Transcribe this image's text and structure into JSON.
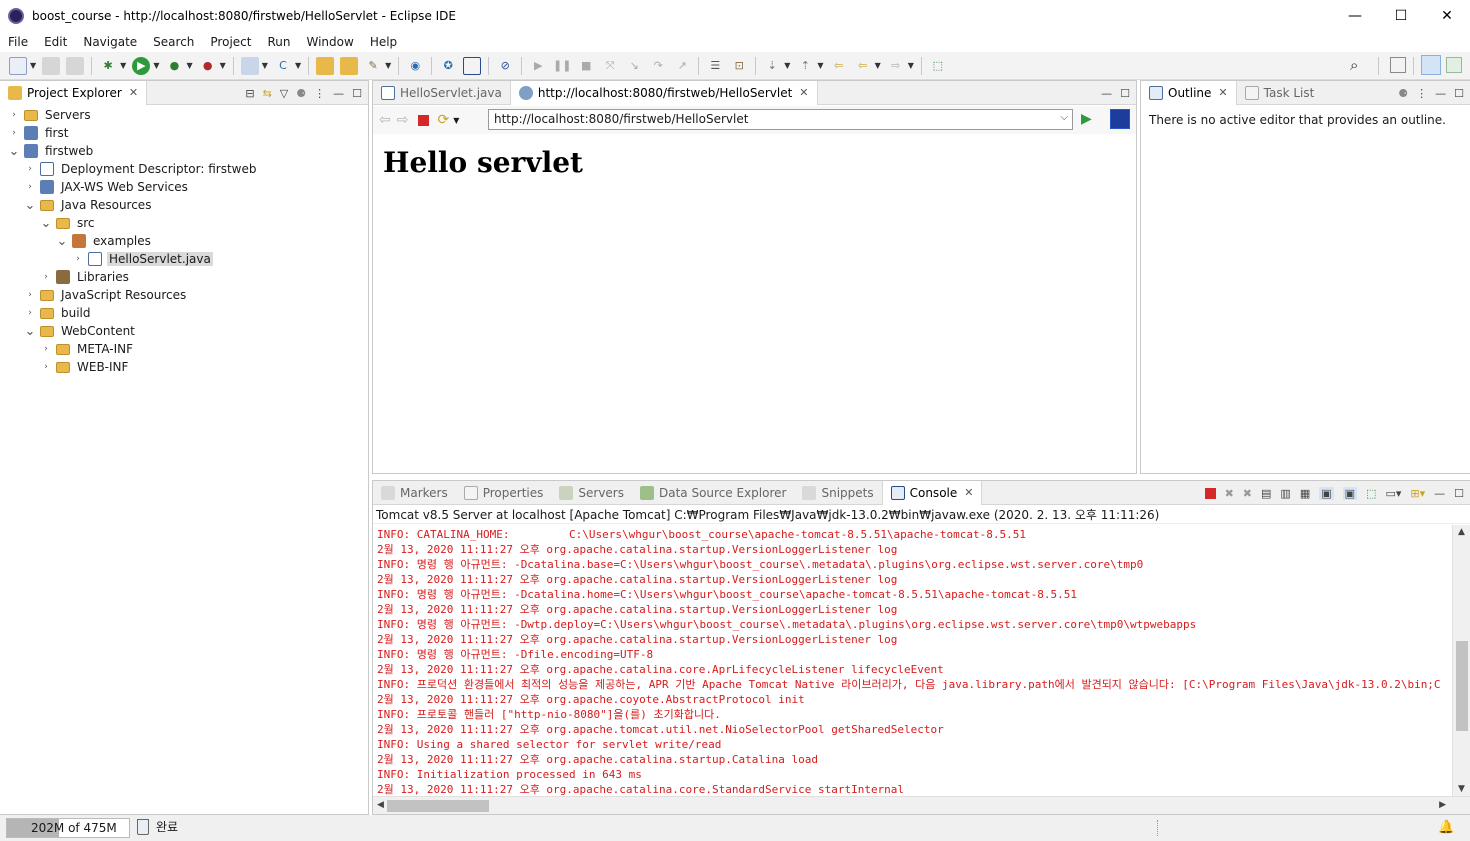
{
  "window": {
    "title": "boost_course - http://localhost:8080/firstweb/HelloServlet - Eclipse IDE",
    "minimize": "—",
    "maximize": "☐",
    "close": "✕"
  },
  "menu": [
    "File",
    "Edit",
    "Navigate",
    "Search",
    "Project",
    "Run",
    "Window",
    "Help"
  ],
  "project_explorer": {
    "tab_label": "Project Explorer",
    "tree": [
      {
        "label": "Servers",
        "depth": 0,
        "expanded": false,
        "icon": "folder"
      },
      {
        "label": "first",
        "depth": 0,
        "expanded": false,
        "icon": "project"
      },
      {
        "label": "firstweb",
        "depth": 0,
        "expanded": true,
        "icon": "project"
      },
      {
        "label": "Deployment Descriptor: firstweb",
        "depth": 1,
        "expanded": false,
        "icon": "descriptor"
      },
      {
        "label": "JAX-WS Web Services",
        "depth": 1,
        "expanded": false,
        "icon": "webservice"
      },
      {
        "label": "Java Resources",
        "depth": 1,
        "expanded": true,
        "icon": "java-resources"
      },
      {
        "label": "src",
        "depth": 2,
        "expanded": true,
        "icon": "folder"
      },
      {
        "label": "examples",
        "depth": 3,
        "expanded": true,
        "icon": "package"
      },
      {
        "label": "HelloServlet.java",
        "depth": 4,
        "expanded": false,
        "icon": "java-file",
        "selected": true
      },
      {
        "label": "Libraries",
        "depth": 2,
        "expanded": false,
        "icon": "library"
      },
      {
        "label": "JavaScript Resources",
        "depth": 1,
        "expanded": false,
        "icon": "js-resources"
      },
      {
        "label": "build",
        "depth": 1,
        "expanded": false,
        "icon": "folder"
      },
      {
        "label": "WebContent",
        "depth": 1,
        "expanded": true,
        "icon": "folder"
      },
      {
        "label": "META-INF",
        "depth": 2,
        "expanded": false,
        "icon": "folder"
      },
      {
        "label": "WEB-INF",
        "depth": 2,
        "expanded": false,
        "icon": "folder"
      }
    ]
  },
  "editor": {
    "tabs": [
      {
        "label": "HelloServlet.java",
        "active": false
      },
      {
        "label": "http://localhost:8080/firstweb/HelloServlet",
        "active": true
      }
    ],
    "url": "http://localhost:8080/firstweb/HelloServlet",
    "page_heading": "Hello servlet"
  },
  "outline": {
    "tabs": [
      {
        "label": "Outline",
        "active": true
      },
      {
        "label": "Task List",
        "active": false
      }
    ],
    "message": "There is no active editor that provides an outline."
  },
  "bottom": {
    "tabs": [
      {
        "label": "Markers",
        "active": false
      },
      {
        "label": "Properties",
        "active": false
      },
      {
        "label": "Servers",
        "active": false
      },
      {
        "label": "Data Source Explorer",
        "active": false
      },
      {
        "label": "Snippets",
        "active": false
      },
      {
        "label": "Console",
        "active": true
      }
    ],
    "console_title": "Tomcat v8.5 Server at localhost [Apache Tomcat] C:₩Program Files₩Java₩jdk-13.0.2₩bin₩javaw.exe (2020. 2. 13. 오후 11:11:26)",
    "lines": [
      "INFO: CATALINA_HOME:         C:\\Users\\whgur\\boost_course\\apache-tomcat-8.5.51\\apache-tomcat-8.5.51",
      "2월 13, 2020 11:11:27 오후 org.apache.catalina.startup.VersionLoggerListener log",
      "INFO: 명령 행 아규먼트: -Dcatalina.base=C:\\Users\\whgur\\boost_course\\.metadata\\.plugins\\org.eclipse.wst.server.core\\tmp0",
      "2월 13, 2020 11:11:27 오후 org.apache.catalina.startup.VersionLoggerListener log",
      "INFO: 명령 행 아규먼트: -Dcatalina.home=C:\\Users\\whgur\\boost_course\\apache-tomcat-8.5.51\\apache-tomcat-8.5.51",
      "2월 13, 2020 11:11:27 오후 org.apache.catalina.startup.VersionLoggerListener log",
      "INFO: 명령 행 아규먼트: -Dwtp.deploy=C:\\Users\\whgur\\boost_course\\.metadata\\.plugins\\org.eclipse.wst.server.core\\tmp0\\wtpwebapps",
      "2월 13, 2020 11:11:27 오후 org.apache.catalina.startup.VersionLoggerListener log",
      "INFO: 명령 행 아규먼트: -Dfile.encoding=UTF-8",
      "2월 13, 2020 11:11:27 오후 org.apache.catalina.core.AprLifecycleListener lifecycleEvent",
      "INFO: 프로덕션 환경들에서 최적의 성능을 제공하는, APR 기반 Apache Tomcat Native 라이브러리가, 다음 java.library.path에서 발견되지 않습니다: [C:\\Program Files\\Java\\jdk-13.0.2\\bin;C",
      "2월 13, 2020 11:11:27 오후 org.apache.coyote.AbstractProtocol init",
      "INFO: 프로토콜 핸들러 [\"http-nio-8080\"]을(를) 초기화합니다.",
      "2월 13, 2020 11:11:27 오후 org.apache.tomcat.util.net.NioSelectorPool getSharedSelector",
      "INFO: Using a shared selector for servlet write/read",
      "2월 13, 2020 11:11:27 오후 org.apache.catalina.startup.Catalina load",
      "INFO: Initialization processed in 643 ms",
      "2월 13, 2020 11:11:27 오후 org.apache.catalina.core.StandardService startInternal"
    ]
  },
  "status": {
    "heap_used": "202M",
    "heap_of": "of 475M",
    "heap_fraction": 0.425,
    "message": "완료"
  },
  "colors": {
    "console_text": "#d61c1c",
    "selection": "#dadada",
    "toolbar_bg": "#f3f3f3"
  }
}
